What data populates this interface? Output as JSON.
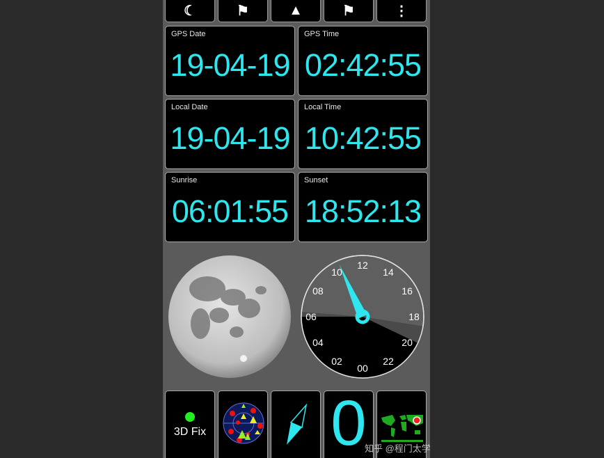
{
  "toolbar": {
    "buttons": [
      {
        "name": "night-mode",
        "icon": "crescent-moon-icon",
        "glyph": "☾"
      },
      {
        "name": "waypoints",
        "icon": "person-flag-icon",
        "glyph": "⚑"
      },
      {
        "name": "navigate",
        "icon": "navigation-arrow-icon",
        "glyph": "▲"
      },
      {
        "name": "track",
        "icon": "flags-icon",
        "glyph": "⚑"
      },
      {
        "name": "more",
        "icon": "more-vertical-icon",
        "glyph": "⋮"
      }
    ]
  },
  "tiles": [
    {
      "label": "GPS Date",
      "value": "19-04-19"
    },
    {
      "label": "GPS Time",
      "value": "02:42:55"
    },
    {
      "label": "Local Date",
      "value": "19-04-19"
    },
    {
      "label": "Local Time",
      "value": "10:42:55"
    },
    {
      "label": "Sunrise",
      "value": "06:01:55"
    },
    {
      "label": "Sunset",
      "value": "18:52:13"
    }
  ],
  "clock": {
    "labels": [
      "00",
      "02",
      "04",
      "06",
      "08",
      "10",
      "12",
      "14",
      "16",
      "18",
      "20",
      "22"
    ],
    "hand_hour": 10.4,
    "accent": "#2ee6ee"
  },
  "bottom": {
    "fix_label": "3D Fix",
    "fix_color": "#22ee22",
    "satellite_count": "0"
  },
  "watermark": "知乎 @程门太学"
}
